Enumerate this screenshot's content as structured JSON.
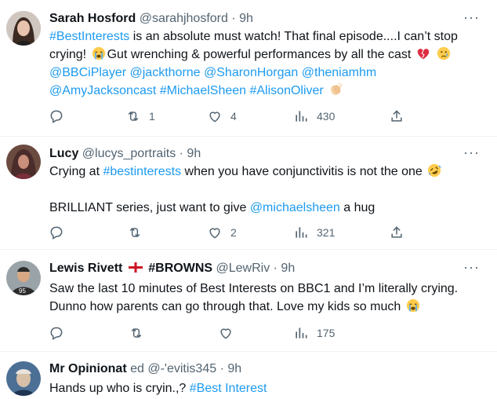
{
  "tweets": [
    {
      "name": "Sarah Hosford",
      "handle": "@sarahjhosford",
      "time": "· 9h",
      "more": "···",
      "avatar_colors": [
        "#3b2a22",
        "#d9b8a6"
      ],
      "lines": [
        [
          {
            "t": "#BestInterests",
            "tag": true
          },
          {
            "t": " is an absolute must watch! That final episode....I can’t stop"
          }
        ],
        [
          {
            "t": "crying! "
          },
          {
            "e": "sob"
          },
          {
            "t": "Gut wrenching & powerful performances by all the cast "
          },
          {
            "e": "broken-heart"
          },
          {
            "t": " "
          },
          {
            "e": "cry"
          }
        ],
        [
          {
            "t": "@BBCiPlayer",
            "tag": true
          },
          {
            "t": " "
          },
          {
            "t": "@jackthorne",
            "tag": true
          },
          {
            "t": " "
          },
          {
            "t": "@SharonHorgan",
            "tag": true
          },
          {
            "t": " "
          },
          {
            "t": "@theniamhm",
            "tag": true
          }
        ],
        [
          {
            "t": "@AmyJacksoncast",
            "tag": true
          },
          {
            "t": " "
          },
          {
            "t": "#MichaelSheen",
            "tag": true
          },
          {
            "t": " "
          },
          {
            "t": "#AlisonOliver",
            "tag": true
          },
          {
            "t": " "
          },
          {
            "e": "clap"
          }
        ]
      ],
      "actions": {
        "reply": "",
        "retweet": "1",
        "like": "4",
        "views": "430"
      }
    },
    {
      "name": "Lucy",
      "handle": "@lucys_portraits",
      "time": "· 9h",
      "more": "···",
      "avatar_colors": [
        "#4a2c2a",
        "#c98f7a"
      ],
      "lines": [
        [
          {
            "t": "Crying at "
          },
          {
            "t": "#bestinterests",
            "tag": true
          },
          {
            "t": " when you have conjunctivitis is not the one "
          },
          {
            "e": "rofl"
          }
        ],
        [],
        [
          {
            "t": "BRILLIANT series, just want to give "
          },
          {
            "t": "@michaelsheen",
            "tag": true
          },
          {
            "t": " a hug"
          }
        ]
      ],
      "actions": {
        "reply": "",
        "retweet": "",
        "like": "2",
        "views": "321"
      }
    },
    {
      "name": "Lewis Rivett",
      "name_suffix": "#BROWNS",
      "handle": "@LewRiv",
      "time": "· 9h",
      "more": "···",
      "avatar_colors": [
        "#2b2b2b",
        "#e2e2e2"
      ],
      "lines": [
        [
          {
            "t": "Saw the last 10 minutes of Best Interests on BBC1 and I’m literally crying."
          }
        ],
        [
          {
            "t": "Dunno how parents can go through that. Love my kids so much "
          },
          {
            "e": "sob"
          }
        ]
      ],
      "actions": {
        "reply": "",
        "retweet": "",
        "like": "",
        "views": "175"
      }
    },
    {
      "name": "Mr Opinionat",
      "handle": "ed @-'evitis345",
      "time": "· 9h",
      "more": "",
      "avatar_colors": [
        "#2e5b8a",
        "#d8c0a8"
      ],
      "lines": [
        [
          {
            "t": "Hands up who is cryin.,? "
          },
          {
            "t": "#Best Interest",
            "tag": true
          }
        ]
      ],
      "actions": null
    }
  ],
  "colors": {
    "link": "#1d9bf0",
    "muted": "#536471",
    "divider": "#eff3f4",
    "england_red": "#ce1124"
  }
}
